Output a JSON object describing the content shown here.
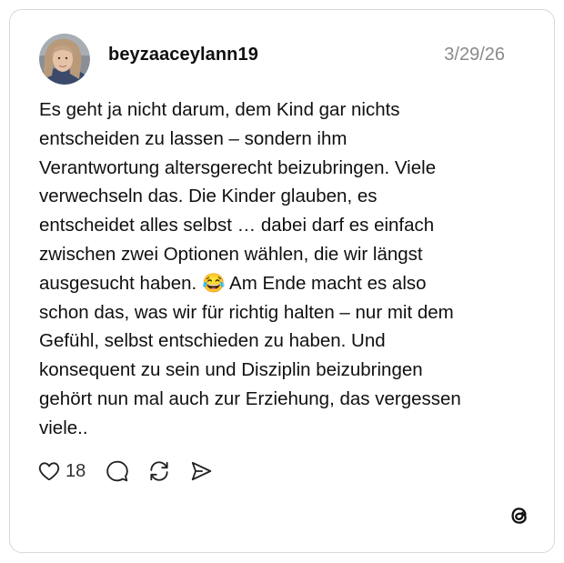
{
  "post": {
    "username": "beyzaaceylann19",
    "date": "3/29/26",
    "text": "Es geht ja nicht darum, dem Kind gar nichts\nentscheiden zu lassen – sondern ihm\nVerantwortung altersgerecht beizubringen. Viele\nverwechseln das. Die Kinder glauben, es\nentscheidet alles selbst … dabei darf es einfach\nzwischen zwei Optionen wählen, die wir längst\nausgesucht haben. 😂 Am Ende macht es also\nschon das, was wir für richtig halten – nur mit dem\nGefühl, selbst entschieden zu haben. Und\nkonsequent zu sein und Disziplin beizubringen\ngehört nun mal auch zur Erziehung, das vergessen\nviele.."
  },
  "actions": {
    "like_count": "18",
    "icons": [
      "heart-icon",
      "comment-icon",
      "repost-icon",
      "share-icon"
    ]
  },
  "branding": {
    "logo": "threads-logo-icon"
  }
}
